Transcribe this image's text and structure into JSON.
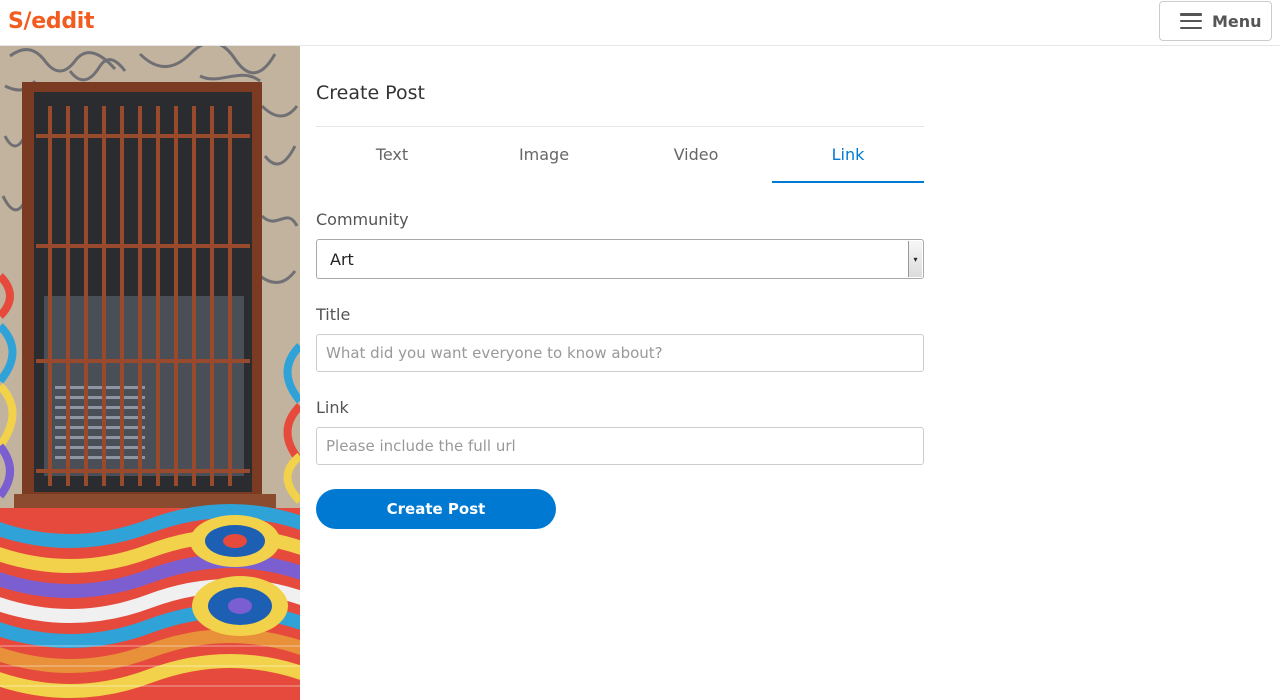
{
  "colors": {
    "brand": "#f25c1f",
    "accent": "#0079d3",
    "text": "#333333",
    "muted": "#999999"
  },
  "header": {
    "logo": "S/eddit",
    "menu_label": "Menu",
    "menu_icon": "hamburger-icon"
  },
  "side_image": {
    "subject": "graffiti-wall-barred-window"
  },
  "form": {
    "page_title": "Create Post",
    "tabs": [
      {
        "label": "Text",
        "active": false
      },
      {
        "label": "Image",
        "active": false
      },
      {
        "label": "Video",
        "active": false
      },
      {
        "label": "Link",
        "active": true
      }
    ],
    "community": {
      "label": "Community",
      "selected": "Art"
    },
    "title": {
      "label": "Title",
      "value": "",
      "placeholder": "What did you want everyone to know about?"
    },
    "link": {
      "label": "Link",
      "value": "",
      "placeholder": "Please include the full url"
    },
    "submit_label": "Create Post"
  }
}
